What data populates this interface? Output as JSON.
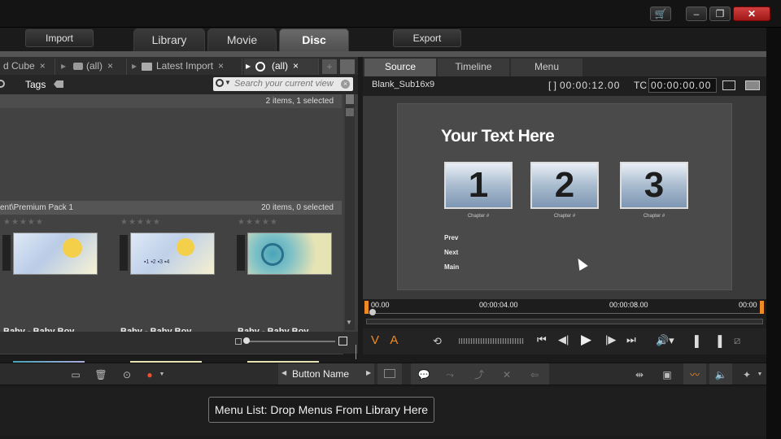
{
  "window": {
    "buttons": [
      "🛒",
      "–",
      "❐",
      "✕"
    ]
  },
  "nav": {
    "import_label": "Import",
    "export_label": "Export",
    "tabs": [
      "Library",
      "Movie",
      "Disc"
    ]
  },
  "library": {
    "tabs": [
      {
        "label": "d Cube"
      },
      {
        "label": "(all)"
      },
      {
        "label": "Latest Import"
      },
      {
        "label": "(all)"
      }
    ],
    "tags_label": "Tags",
    "search_placeholder": "Search your current view",
    "status_top": "2 items, 1 selected",
    "path_label": "ent\\Premium Pack 1",
    "status_mid": "20 items, 0 selected",
    "items": [
      {
        "title": "Baby - Baby Boy ..."
      },
      {
        "title": "Baby - Baby Boy ..."
      },
      {
        "title": "Baby - Baby Boy ..."
      }
    ]
  },
  "player": {
    "tabs": [
      "Source",
      "Timeline",
      "Menu"
    ],
    "clip_name": "Blank_Sub16x9",
    "duration": "00:00:12.00",
    "tc_label": "TC",
    "tc_value": "00:00:00.00",
    "menu_title": "Your Text Here",
    "chapters": [
      {
        "number": "1",
        "label": "Chapter #"
      },
      {
        "number": "2",
        "label": "Chapter #"
      },
      {
        "number": "3",
        "label": "Chapter #"
      }
    ],
    "menu_links": [
      "Prev",
      "Next",
      "Main"
    ],
    "ruler": [
      "00.00",
      "00:00:04.00",
      "00:00:08.00",
      "00:00"
    ],
    "va_label": "V A"
  },
  "toolbar": {
    "button_name_label": "Button Name"
  },
  "menu_list": {
    "tip": "Menu List: Drop Menus From Library Here"
  },
  "colors": {
    "accent": "#f08a24",
    "close_red": "#c42b2b"
  }
}
